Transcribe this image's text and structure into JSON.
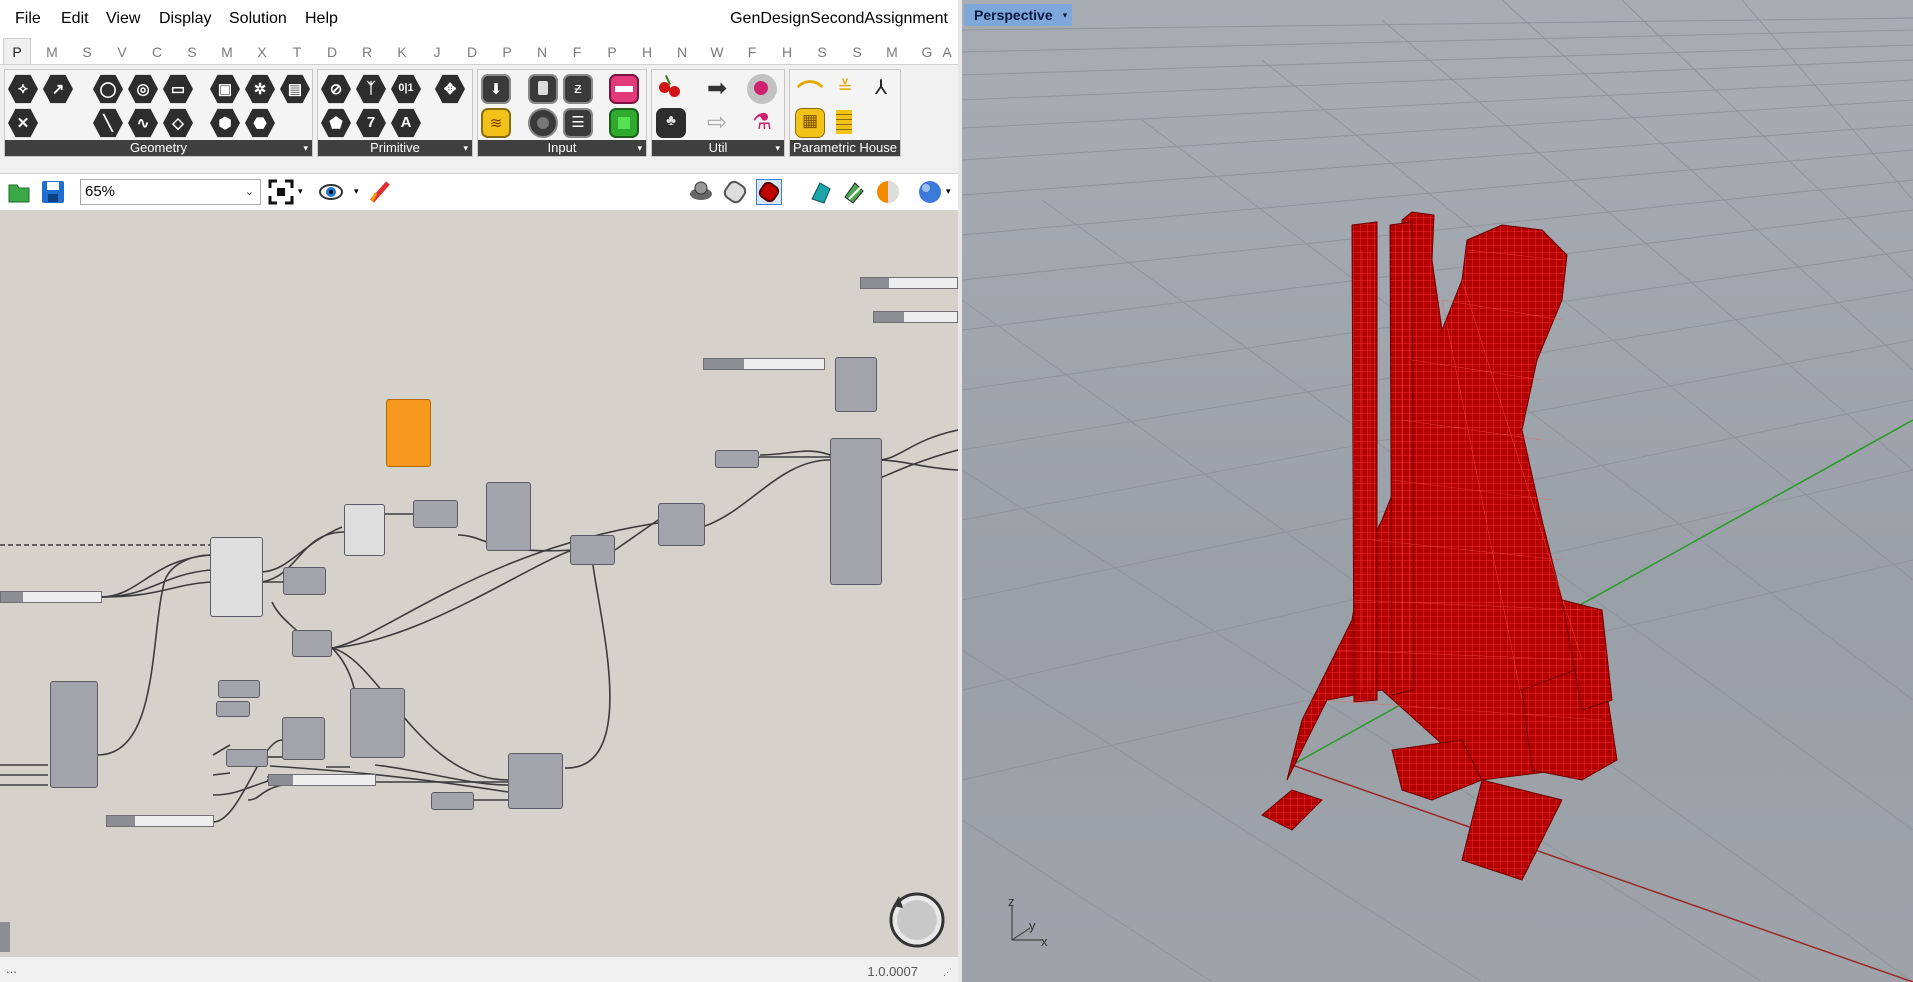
{
  "menubar": {
    "items": [
      "File",
      "Edit",
      "View",
      "Display",
      "Solution",
      "Help"
    ],
    "document_title": "GenDesignSecondAssignment"
  },
  "tabs": [
    "P",
    "M",
    "S",
    "V",
    "C",
    "S",
    "M",
    "X",
    "T",
    "D",
    "R",
    "K",
    "J",
    "D",
    "P",
    "N",
    "F",
    "P",
    "H",
    "N",
    "W",
    "F",
    "H",
    "S",
    "S",
    "M",
    "G",
    "A"
  ],
  "ribbon": {
    "groups": [
      "Geometry",
      "Primitive",
      "Input",
      "Util",
      "Parametric House"
    ],
    "expand_glyph": "▾",
    "primitive_icons": {
      "seven": "7",
      "text": "A",
      "binary": "0|1"
    }
  },
  "toolbar": {
    "zoom_value": "65%",
    "icons": [
      "open-file-icon",
      "save-icon",
      "zoom-extents-icon",
      "preview-eye-icon",
      "sketch-icon",
      "preview-off-icon",
      "preview-wireframe-icon",
      "preview-shaded-icon",
      "bake-icon",
      "mesh-settings-icon",
      "document-preview-icon",
      "sphere-icon"
    ]
  },
  "status": {
    "left_text": "...",
    "version": "1.0.0007"
  },
  "viewport": {
    "label": "Perspective",
    "axis_x": "x",
    "axis_y": "y",
    "axis_z": "z",
    "model_color": "#cc0000"
  },
  "colors": {
    "canvas": "#d5d2cb",
    "node": "#a3a3ab",
    "selected_node": "#f6991e",
    "ribbon_footer": "#3f3f3f",
    "viewport_tab": "#7ea7da"
  }
}
